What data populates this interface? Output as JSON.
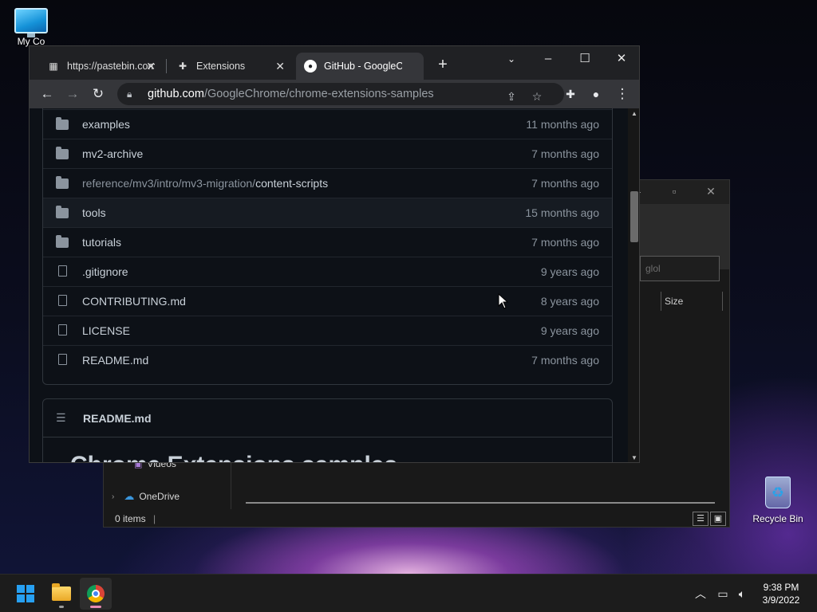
{
  "desktop": {
    "this_pc_label": "My Co",
    "recycle_bin_label": "Recycle Bin"
  },
  "chrome": {
    "tabs": [
      {
        "label": "https://pastebin.com",
        "icon": "pastebin-icon"
      },
      {
        "label": "Extensions",
        "icon": "puzzle-icon"
      },
      {
        "label": "GitHub - GoogleChrome",
        "icon": "github-icon"
      }
    ],
    "url_host": "github.com",
    "url_path": "/GoogleChrome/chrome-extensions-samples"
  },
  "repo": {
    "files": [
      {
        "type": "folder",
        "name": "examples",
        "prefix": "",
        "date": "11 months ago"
      },
      {
        "type": "folder",
        "name": "mv2-archive",
        "prefix": "",
        "date": "7 months ago"
      },
      {
        "type": "folder",
        "name": "content-scripts",
        "prefix": "reference/mv3/intro/mv3-migration/",
        "date": "7 months ago"
      },
      {
        "type": "folder",
        "name": "tools",
        "prefix": "",
        "date": "15 months ago"
      },
      {
        "type": "folder",
        "name": "tutorials",
        "prefix": "",
        "date": "7 months ago"
      },
      {
        "type": "file",
        "name": ".gitignore",
        "prefix": "",
        "date": "9 years ago"
      },
      {
        "type": "file",
        "name": "CONTRIBUTING.md",
        "prefix": "",
        "date": "8 years ago"
      },
      {
        "type": "file",
        "name": "LICENSE",
        "prefix": "",
        "date": "9 years ago"
      },
      {
        "type": "file",
        "name": "README.md",
        "prefix": "",
        "date": "7 months ago"
      }
    ],
    "readme_title": "README.md",
    "readme_heading": "Chrome Extensions samples"
  },
  "explorer": {
    "search_placeholder": "glol",
    "size_column": "Size",
    "nav_videos": "Videos",
    "nav_onedrive": "OneDrive",
    "status": "0 items"
  },
  "taskbar": {
    "time": "9:38 PM",
    "date": "3/9/2022"
  }
}
